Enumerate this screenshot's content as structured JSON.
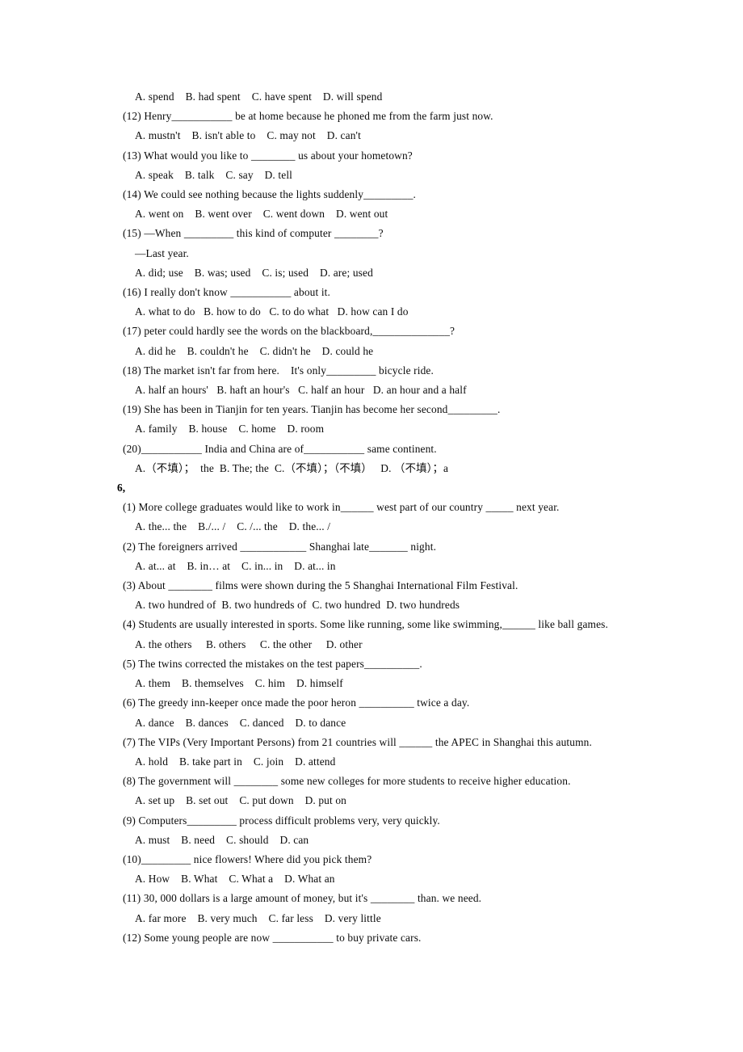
{
  "document": {
    "type": "worksheet",
    "subject": "English grammar multiple-choice exercises",
    "blocks": [
      {
        "id": "block-5-tail",
        "lines": [
          {
            "kind": "options",
            "text": "A. spend    B. had spent    C. have spent    D. will spend"
          },
          {
            "kind": "question",
            "text": "(12) Henry___________ be at home because he phoned me from the farm just now."
          },
          {
            "kind": "options",
            "text": "A. mustn't    B. isn't able to    C. may not    D. can't"
          },
          {
            "kind": "question",
            "text": "(13) What would you like to ________ us about your hometown?"
          },
          {
            "kind": "options",
            "text": "A. speak    B. talk    C. say    D. tell"
          },
          {
            "kind": "question",
            "text": "(14) We could see nothing because the lights suddenly_________."
          },
          {
            "kind": "options",
            "text": "A. went on    B. went over    C. went down    D. went out"
          },
          {
            "kind": "question",
            "text": "(15) —When _________ this kind of computer ________?"
          },
          {
            "kind": "continuation",
            "text": "—Last year."
          },
          {
            "kind": "options",
            "text": "A. did; use    B. was; used    C. is; used    D. are; used"
          },
          {
            "kind": "question",
            "text": "(16) I really don't know ___________ about it."
          },
          {
            "kind": "options",
            "text": "A. what to do   B. how to do   C. to do what   D. how can I do"
          },
          {
            "kind": "question",
            "text": "(17) peter could hardly see the words on the blackboard,______________?"
          },
          {
            "kind": "options",
            "text": "A. did he    B. couldn't he    C. didn't he    D. could he"
          },
          {
            "kind": "question",
            "text": "(18) The market isn't far from here.    It's only_________ bicycle ride."
          },
          {
            "kind": "options",
            "text": "A. half an hours'   B. haft an hour's   C. half an hour   D. an hour and a half"
          },
          {
            "kind": "question",
            "text": "(19) She has been in Tianjin for ten years. Tianjin has become her second_________."
          },
          {
            "kind": "options",
            "text": "A. family    B. house    C. home    D. room"
          },
          {
            "kind": "question",
            "text": "(20)___________ India and China are of___________ same continent."
          },
          {
            "kind": "options",
            "text": "A.（不填）；  the  B. The; the  C.（不填）；（不填）   D. （不填）；a"
          }
        ]
      },
      {
        "id": "block-6",
        "heading": "6,",
        "lines": [
          {
            "kind": "question",
            "text": "(1) More college graduates would like to work in______ west part of our country _____ next year."
          },
          {
            "kind": "options",
            "text": "A. the... the    B./... /    C. /... the    D. the... /"
          },
          {
            "kind": "question",
            "text": "(2) The foreigners arrived ____________ Shanghai late_______ night."
          },
          {
            "kind": "options",
            "text": "A. at... at    B. in… at    C. in... in    D. at... in"
          },
          {
            "kind": "question",
            "text": "(3) About ________ films were shown during the 5 Shanghai International Film Festival."
          },
          {
            "kind": "options",
            "text": "A. two hundred of  B. two hundreds of  C. two hundred  D. two hundreds"
          },
          {
            "kind": "question",
            "text": "(4) Students are usually interested in sports. Some like running, some like swimming,______ like ball games."
          },
          {
            "kind": "options",
            "text": "A. the others     B. others     C. the other     D. other"
          },
          {
            "kind": "question",
            "text": "(5) The twins corrected the mistakes on the test papers__________."
          },
          {
            "kind": "options",
            "text": "A. them    B. themselves    C. him    D. himself"
          },
          {
            "kind": "question",
            "text": "(6) The greedy inn-keeper once made the poor heron __________ twice a day."
          },
          {
            "kind": "options",
            "text": "A. dance    B. dances    C. danced    D. to dance"
          },
          {
            "kind": "question",
            "text": "(7) The VIPs (Very Important Persons) from 21 countries will ______ the APEC in Shanghai this autumn."
          },
          {
            "kind": "options",
            "text": "A. hold    B. take part in    C. join    D. attend"
          },
          {
            "kind": "question",
            "text": "(8) The government will ________ some new colleges for more students to receive higher education."
          },
          {
            "kind": "options",
            "text": "A. set up    B. set out    C. put down    D. put on"
          },
          {
            "kind": "question",
            "text": "(9) Computers_________ process difficult problems very, very quickly."
          },
          {
            "kind": "options",
            "text": "A. must    B. need    C. should    D. can"
          },
          {
            "kind": "question",
            "text": "(10)_________ nice flowers! Where did you pick them?"
          },
          {
            "kind": "options",
            "text": "A. How    B. What    C. What a    D. What an"
          },
          {
            "kind": "question",
            "text": "(11) 30, 000 dollars is a large amount of money, but it's ________ than. we need."
          },
          {
            "kind": "options",
            "text": "A. far more    B. very much    C. far less    D. very little"
          },
          {
            "kind": "question",
            "text": "(12) Some young people are now ___________ to buy private cars."
          }
        ]
      }
    ]
  }
}
